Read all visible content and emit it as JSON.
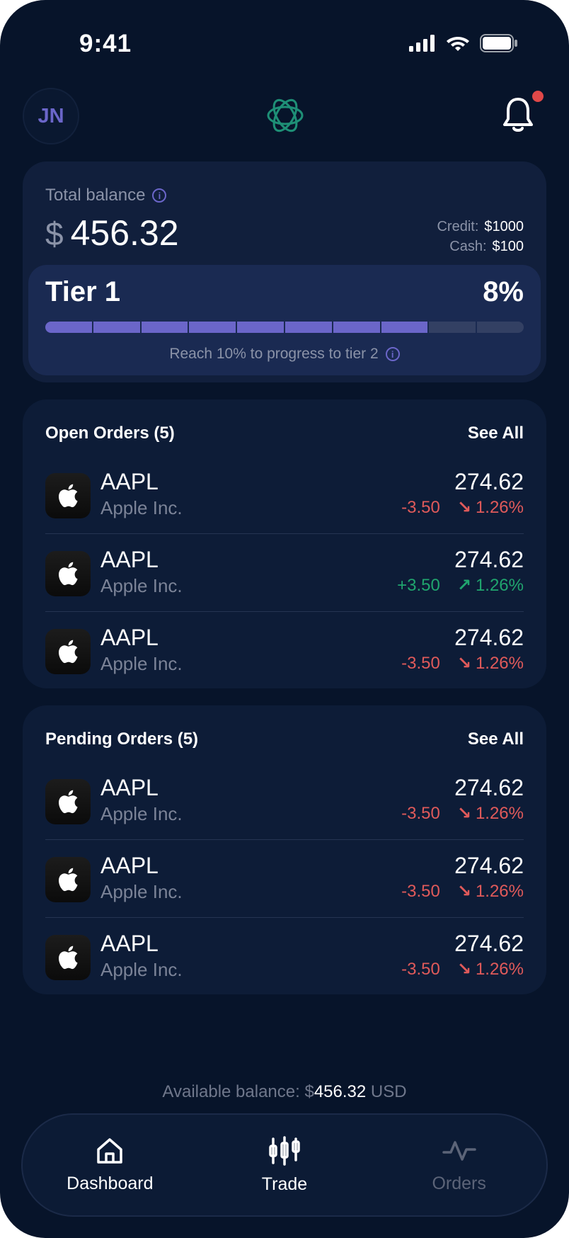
{
  "status_bar": {
    "time": "9:41"
  },
  "header": {
    "avatar_initials": "JN",
    "has_notification": true
  },
  "balance": {
    "label": "Total balance",
    "currency_symbol": "$",
    "amount": "456.32",
    "credit_label": "Credit:",
    "credit_value": "$1000",
    "cash_label": "Cash:",
    "cash_value": "$100"
  },
  "tier": {
    "name": "Tier 1",
    "percent": "8%",
    "progress_segments_total": 10,
    "progress_segments_filled": 8,
    "hint": "Reach 10% to progress to tier 2"
  },
  "open_orders": {
    "title": "Open Orders (5)",
    "see_all": "See All",
    "items": [
      {
        "ticker": "AAPL",
        "company": "Apple Inc.",
        "price": "274.62",
        "change": "-3.50",
        "change_pct": "1.26%",
        "direction": "down"
      },
      {
        "ticker": "AAPL",
        "company": "Apple Inc.",
        "price": "274.62",
        "change": "+3.50",
        "change_pct": "1.26%",
        "direction": "up"
      },
      {
        "ticker": "AAPL",
        "company": "Apple Inc.",
        "price": "274.62",
        "change": "-3.50",
        "change_pct": "1.26%",
        "direction": "down"
      }
    ]
  },
  "pending_orders": {
    "title": "Pending Orders (5)",
    "see_all": "See All",
    "items": [
      {
        "ticker": "AAPL",
        "company": "Apple Inc.",
        "price": "274.62",
        "change": "-3.50",
        "change_pct": "1.26%",
        "direction": "down"
      },
      {
        "ticker": "AAPL",
        "company": "Apple Inc.",
        "price": "274.62",
        "change": "-3.50",
        "change_pct": "1.26%",
        "direction": "down"
      },
      {
        "ticker": "AAPL",
        "company": "Apple Inc.",
        "price": "274.62",
        "change": "-3.50",
        "change_pct": "1.26%",
        "direction": "down"
      }
    ]
  },
  "available_balance": {
    "label": "Available balance:",
    "currency_symbol": "$",
    "value": "456.32",
    "unit": "USD"
  },
  "nav": {
    "items": [
      {
        "label": "Dashboard",
        "icon": "home-icon",
        "active": true
      },
      {
        "label": "Trade",
        "icon": "candlestick-icon",
        "active": true
      },
      {
        "label": "Orders",
        "icon": "activity-icon",
        "active": false
      }
    ]
  },
  "colors": {
    "background": "#07142a",
    "card": "#0d1c37",
    "accent": "#6b66c9",
    "negative": "#e05a5a",
    "positive": "#20a56e",
    "notification": "#e04848"
  }
}
